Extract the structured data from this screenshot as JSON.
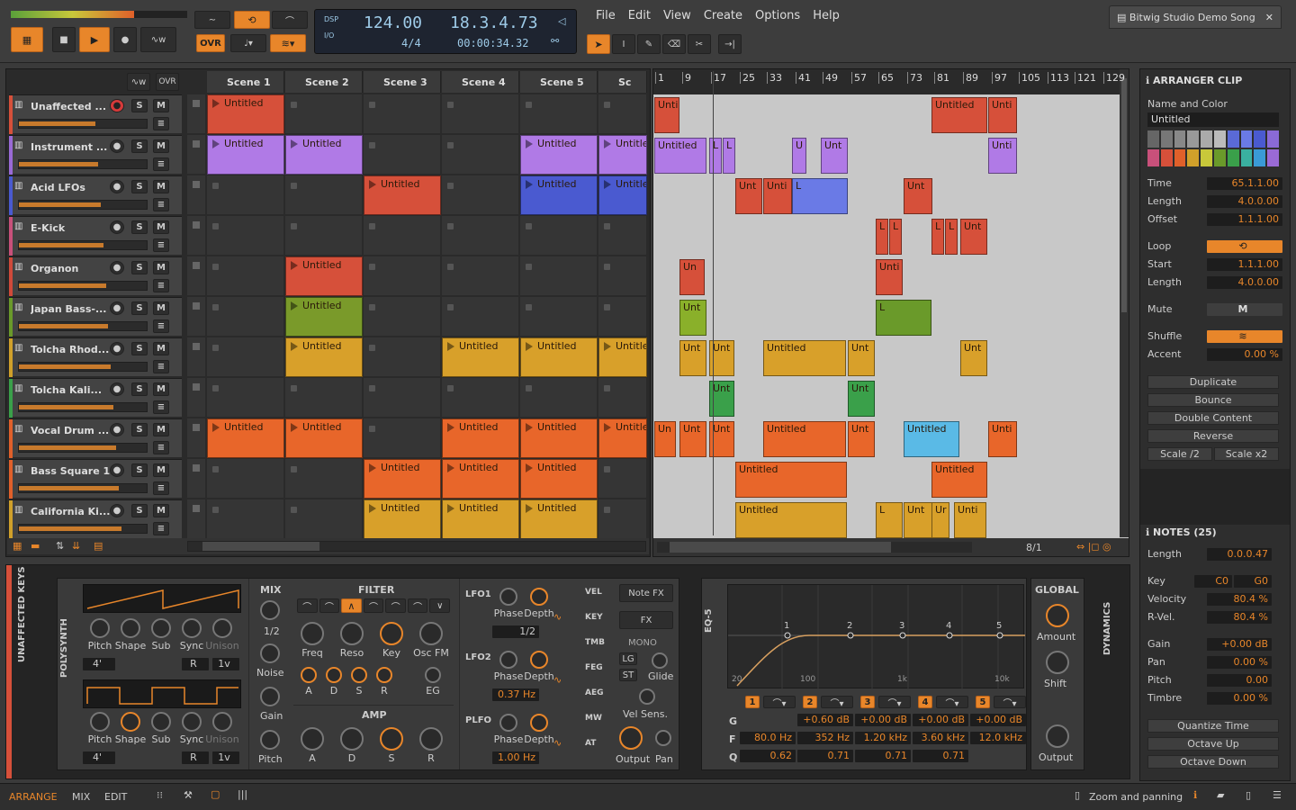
{
  "transport": {
    "tempo": "124.00",
    "time_sig": "4/4",
    "position": "18.3.4.73",
    "time": "00:00:34.32",
    "dsp": "DSP",
    "io": "I/O",
    "ovr": "OVR"
  },
  "menu": [
    "File",
    "Edit",
    "View",
    "Create",
    "Options",
    "Help"
  ],
  "project_tab": "Bitwig Studio Demo Song",
  "scenes": [
    "Scene 1",
    "Scene 2",
    "Scene 3",
    "Scene 4",
    "Scene 5",
    "Sc"
  ],
  "tracks": [
    {
      "name": "Unaffected ...",
      "color": "#d6503a"
    },
    {
      "name": "Instrument ...",
      "color": "#9a6ad6"
    },
    {
      "name": "Acid LFOs",
      "color": "#4a5ad0"
    },
    {
      "name": "E-Kick",
      "color": "#c8507a"
    },
    {
      "name": "Organon",
      "color": "#d04a3a"
    },
    {
      "name": "Japan Bass-...",
      "color": "#6a9a2a"
    },
    {
      "name": "Tolcha Rhod...",
      "color": "#d0a02a"
    },
    {
      "name": "Tolcha Kali...",
      "color": "#3aa04a"
    },
    {
      "name": "Vocal Drum ...",
      "color": "#e0602a"
    },
    {
      "name": "Bass Square 1",
      "color": "#e0602a"
    },
    {
      "name": "California Ki...",
      "color": "#d0a02a"
    }
  ],
  "clip_label": "Untitled",
  "ruler": [
    "1",
    "9",
    "17",
    "25",
    "33",
    "41",
    "49",
    "57",
    "65",
    "73",
    "81",
    "89",
    "97",
    "105",
    "113",
    "121",
    "129"
  ],
  "arranger_short": [
    "Unt",
    "Unti",
    "Un",
    "U",
    "Ur",
    "L"
  ],
  "zoom": "8/1",
  "inspector": {
    "title": "ARRANGER CLIP",
    "name_label": "Name and Color",
    "name_value": "Untitled",
    "time_label": "Time",
    "time": "65.1.1.00",
    "length_label": "Length",
    "length": "4.0.0.00",
    "offset_label": "Offset",
    "offset": "1.1.1.00",
    "loop_label": "Loop",
    "start_label": "Start",
    "start": "1.1.1.00",
    "loop_length": "4.0.0.00",
    "mute_label": "Mute",
    "mute": "M",
    "shuffle_label": "Shuffle",
    "accent_label": "Accent",
    "accent": "0.00 %",
    "actions": [
      "Duplicate",
      "Bounce",
      "Double Content",
      "Reverse"
    ],
    "scale_half": "Scale /2",
    "scale_double": "Scale x2",
    "notes_title": "NOTES (25)",
    "note_length": "0.0.0.47",
    "key_label": "Key",
    "key_lo": "C0",
    "key_hi": "G0",
    "velocity_label": "Velocity",
    "velocity": "80.4 %",
    "rvel_label": "R-Vel.",
    "rvel": "80.4 %",
    "gain_label": "Gain",
    "gain": "+0.00 dB",
    "pan_label": "Pan",
    "pan": "0.00 %",
    "pitch_label": "Pitch",
    "pitch": "0.00",
    "timbre_label": "Timbre",
    "timbre": "0.00 %",
    "quantize": "Quantize Time",
    "octave_up": "Octave Up",
    "octave_down": "Octave Down"
  },
  "devices": {
    "track_label": "UNAFFECTED KEYS",
    "polysynth": "POLYSYNTH",
    "osc1": {
      "knobs": [
        "Pitch",
        "Shape",
        "Sub",
        "Sync",
        "Unison"
      ],
      "oct": "4'",
      "r": "R",
      "v": "1v"
    },
    "osc2": {
      "knobs": [
        "Pitch",
        "Shape",
        "Sub",
        "Sync",
        "Unison"
      ],
      "oct": "4'",
      "r": "R",
      "v": "1v"
    },
    "mix": "MIX",
    "mix_ratio": "1/2",
    "noise": "Noise",
    "gain": "Gain",
    "pitch": "Pitch",
    "filter": "FILTER",
    "filter_knobs": [
      "Freq",
      "Reso",
      "Key",
      "Osc FM"
    ],
    "env": [
      "A",
      "D",
      "S",
      "R",
      "EG"
    ],
    "amp": "AMP",
    "amp_knobs": [
      "A",
      "D",
      "S",
      "R"
    ],
    "lfo1": "LFO1",
    "lfo2": "LFO2",
    "plfo": "PLFO",
    "phase": "Phase",
    "depth": "Depth",
    "lfo1_rate": "1/2",
    "lfo2_rate": "0.37 Hz",
    "plfo_rate": "1.00 Hz",
    "mods": [
      "VEL",
      "KEY",
      "TMB",
      "FEG",
      "AEG",
      "MW",
      "AT"
    ],
    "note_fx": "Note FX",
    "fx": "FX",
    "mono": "MONO",
    "lg": "LG",
    "st": "ST",
    "glide": "Glide",
    "vel_sens": "Vel Sens.",
    "output": "Output",
    "pan": "Pan",
    "eq_name": "EQ-5",
    "eq_points": [
      "1",
      "2",
      "3",
      "4",
      "5"
    ],
    "eq_freq_labels": [
      "20",
      "100",
      "1k",
      "10k"
    ],
    "eq_gains": [
      "+0.60 dB",
      "+0.00 dB",
      "+0.00 dB",
      "+0.00 dB"
    ],
    "eq_freqs": [
      "80.0 Hz",
      "352 Hz",
      "1.20 kHz",
      "3.60 kHz",
      "12.0 kHz"
    ],
    "eq_qs": [
      "0.62",
      "0.71",
      "0.71",
      "0.71"
    ],
    "eq_g": "G",
    "eq_f": "F",
    "eq_q": "Q",
    "global": "GLOBAL",
    "amount": "Amount",
    "shift": "Shift",
    "global_output": "Output",
    "dynamics": "DYNAMICS"
  },
  "status": {
    "arrange": "ARRANGE",
    "mix": "MIX",
    "edit": "EDIT",
    "hint": "Zoom and panning"
  }
}
